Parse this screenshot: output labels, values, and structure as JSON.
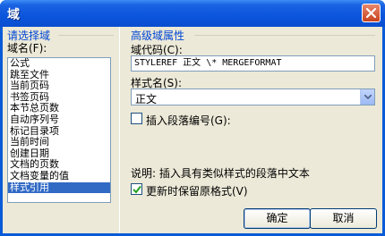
{
  "window": {
    "title": "域"
  },
  "left": {
    "header": "请选择域",
    "list_label": "域名(F):",
    "items": [
      "公式",
      "跳至文件",
      "当前页码",
      "书签页码",
      "本节总页数",
      "自动序列号",
      "标记目录项",
      "当前时间",
      "创建日期",
      "文档的页数",
      "文档变量的值",
      "样式引用"
    ],
    "selected_index": 11
  },
  "right": {
    "header": "高级域属性",
    "field_code_label": "域代码(C):",
    "field_code_value": "STYLEREF  正文 \\* MERGEFORMAT",
    "style_label": "样式名(S):",
    "style_value": "正文",
    "insert_para_label": "插入段落编号(G):",
    "insert_para_checked": false,
    "description": "说明: 插入具有类似样式的段落中文本",
    "preserve_label": "更新时保留原格式(V)",
    "preserve_checked": true
  },
  "buttons": {
    "ok": "确定",
    "cancel": "取消"
  },
  "icons": {
    "close": "close-icon",
    "dropdown": "chevron-down-icon",
    "check": "check-icon"
  }
}
